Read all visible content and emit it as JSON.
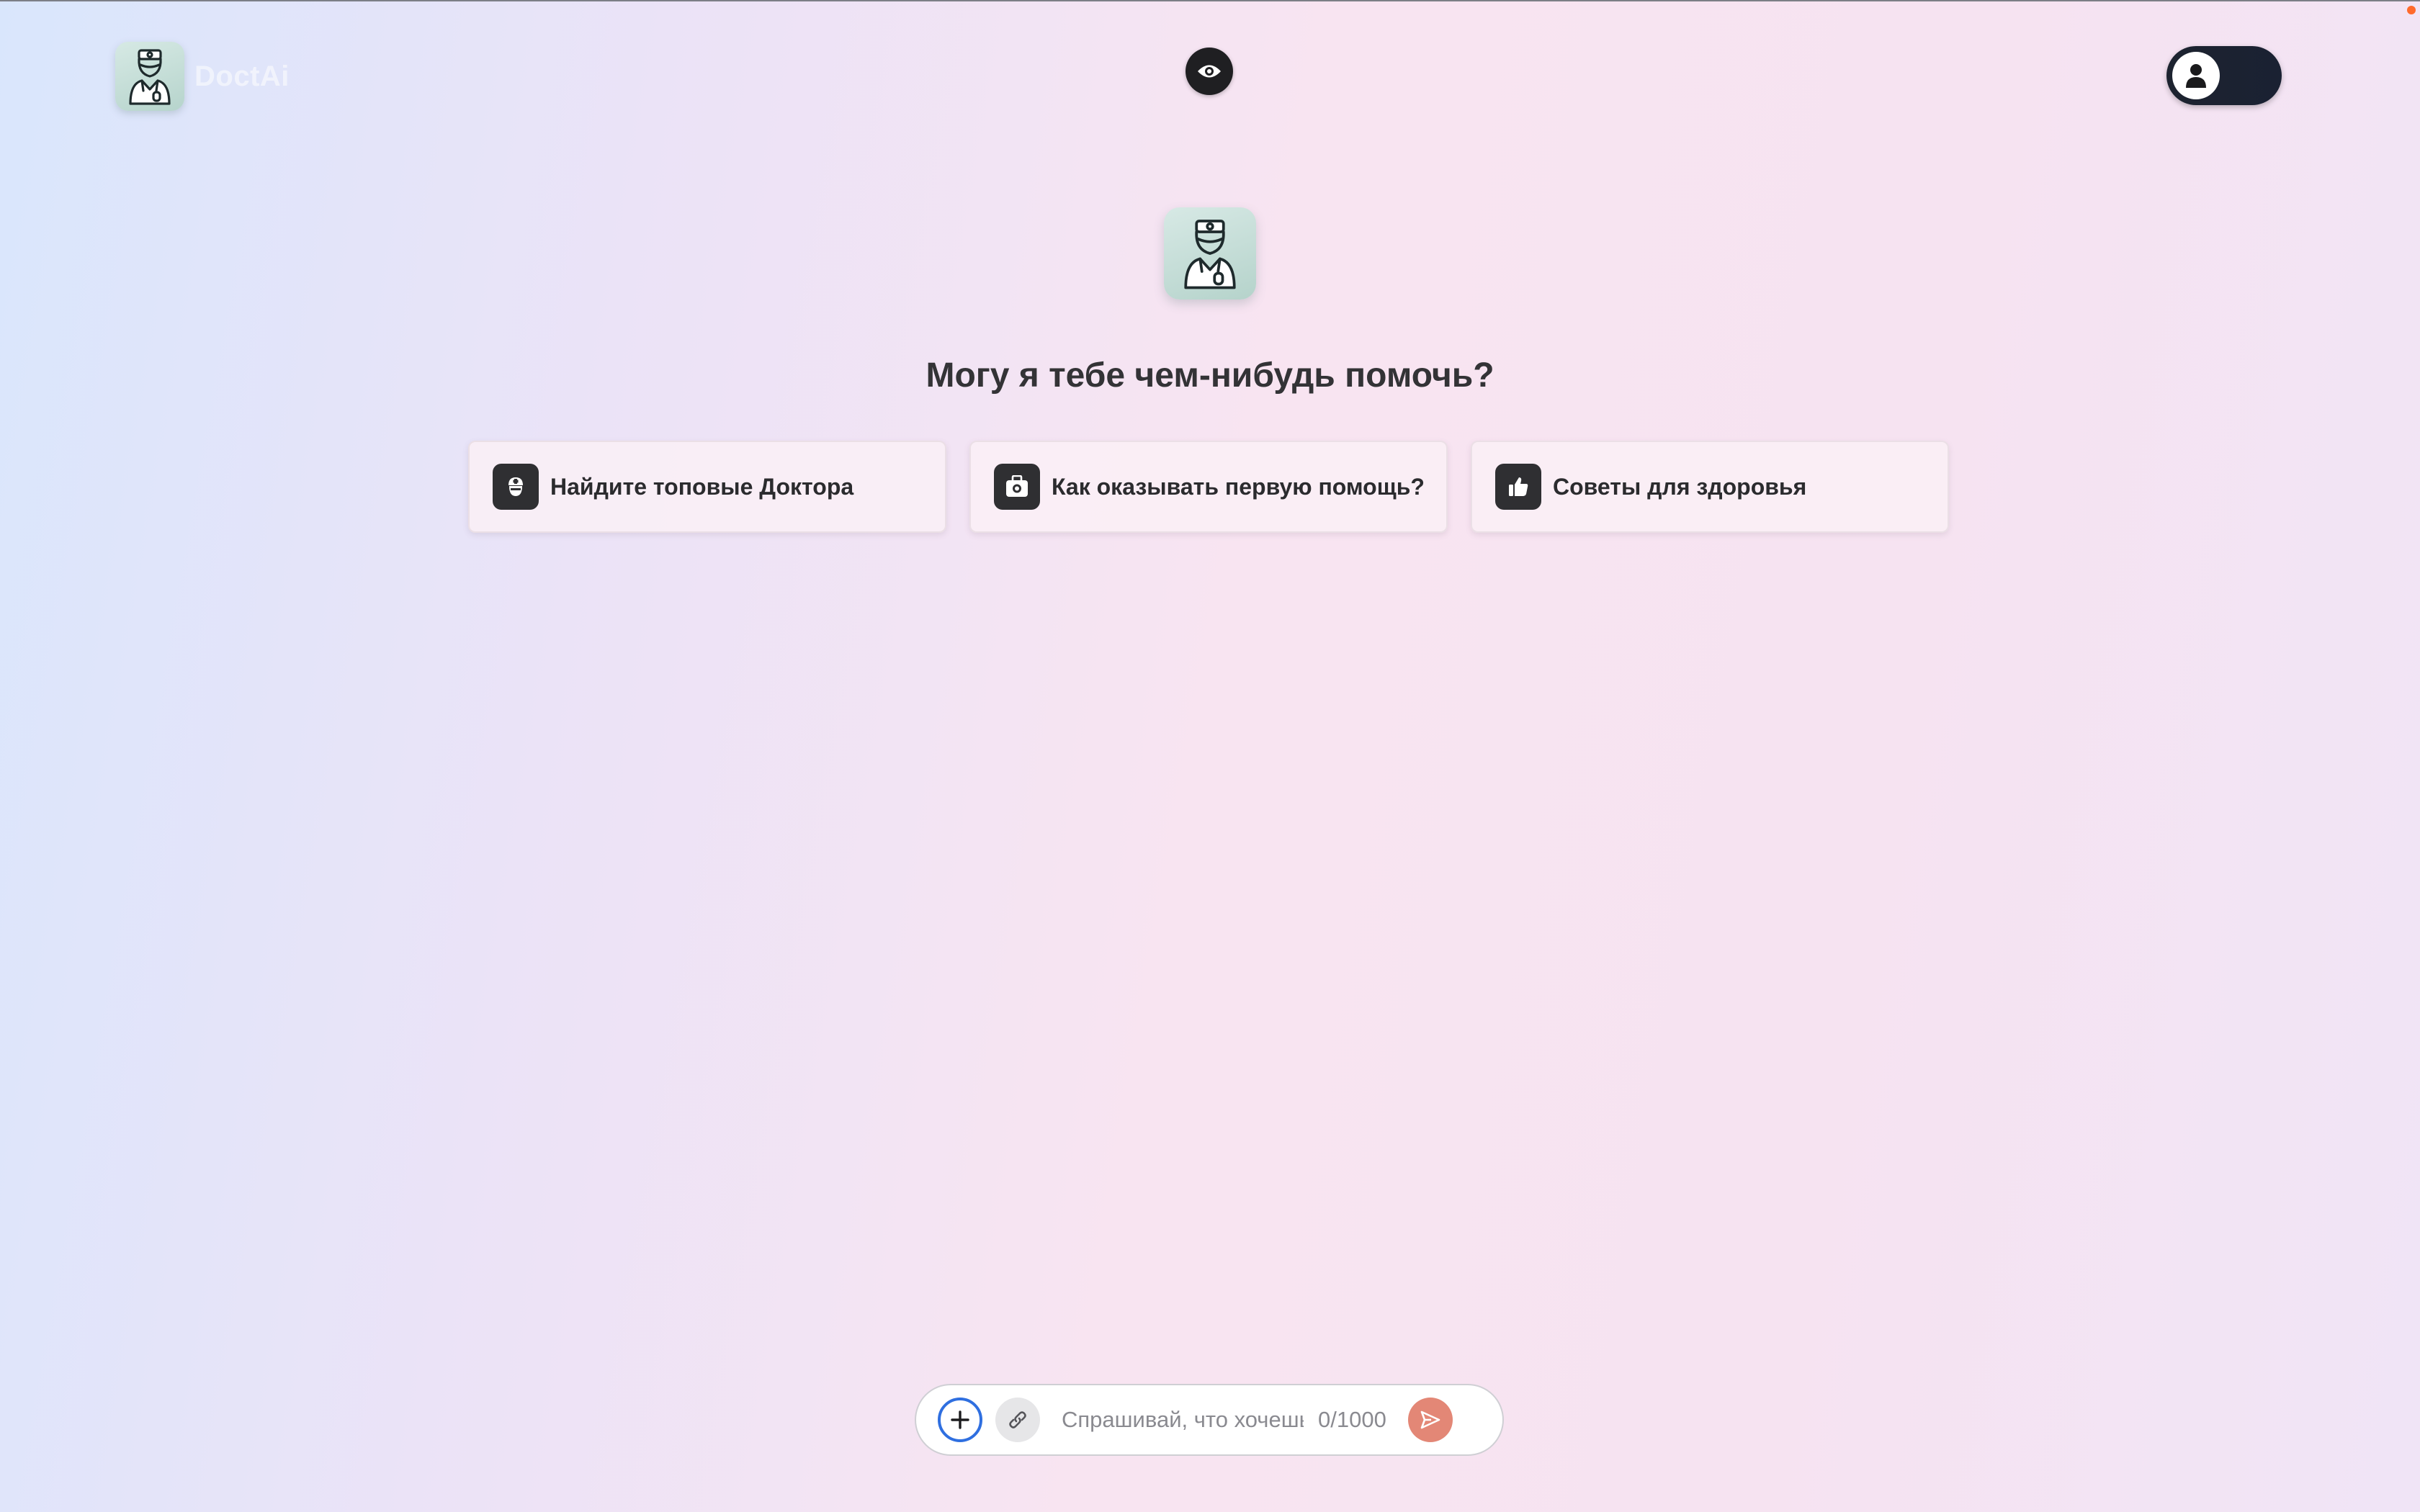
{
  "header": {
    "logo_text": "DoctAi",
    "logo_icon": "doctor-icon",
    "center_icon": "eye-icon",
    "toggle_icon": "user-icon"
  },
  "hero": {
    "avatar_icon": "doctor-icon",
    "title": "Могу я тебе чем-нибудь помочь?"
  },
  "suggestions": [
    {
      "icon": "doctor-mask-icon",
      "label": "Найдите топовые Доктора"
    },
    {
      "icon": "first-aid-kit-icon",
      "label": "Как оказывать первую помощь?"
    },
    {
      "icon": "thumbs-up-icon",
      "label": "Советы для здоровья"
    }
  ],
  "composer": {
    "placeholder": "Спрашивай, что хочешь",
    "counter": "0/1000",
    "plus_icon": "plus-icon",
    "attach_icon": "link-icon",
    "send_icon": "send-icon"
  },
  "colors": {
    "send_button": "#e38776",
    "plus_border": "#2f6fe0",
    "toggle_bg": "#1d2330",
    "logo_bg": "#c5dfd8"
  }
}
